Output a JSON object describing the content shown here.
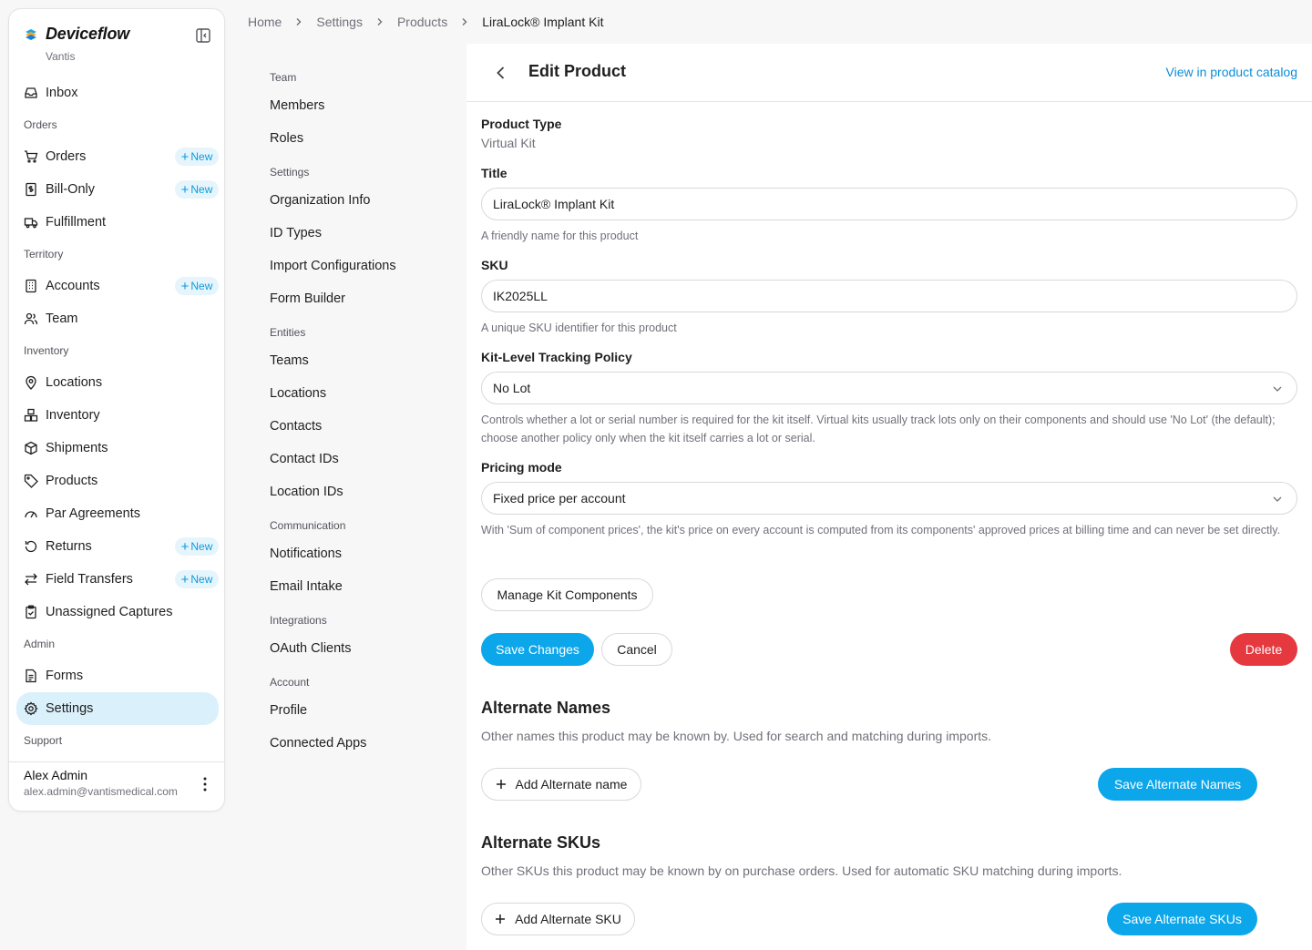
{
  "brand": {
    "name": "Deviceflow",
    "org": "Vantis"
  },
  "colors": {
    "accent": "#0ca6ea",
    "danger": "#e5383f",
    "active_nav_bg": "#daf0fb",
    "link": "#0b8fd8"
  },
  "sidebar": {
    "inbox": {
      "label": "Inbox",
      "icon": "inbox-icon"
    },
    "sections": {
      "orders": "Orders",
      "territory": "Territory",
      "inventory": "Inventory",
      "admin": "Admin",
      "support": "Support"
    },
    "new_label": "New",
    "orders": {
      "label": "Orders",
      "icon": "cart-icon"
    },
    "bill_only": {
      "label": "Bill-Only",
      "icon": "dollar-doc-icon"
    },
    "fulfillment": {
      "label": "Fulfillment",
      "icon": "truck-icon"
    },
    "accounts": {
      "label": "Accounts",
      "icon": "building-icon"
    },
    "team": {
      "label": "Team",
      "icon": "users-icon"
    },
    "locations": {
      "label": "Locations",
      "icon": "map-pin-icon"
    },
    "inventory": {
      "label": "Inventory",
      "icon": "boxes-icon"
    },
    "shipments": {
      "label": "Shipments",
      "icon": "package-icon"
    },
    "products": {
      "label": "Products",
      "icon": "tag-icon"
    },
    "par_agreements": {
      "label": "Par Agreements",
      "icon": "gauge-icon"
    },
    "returns": {
      "label": "Returns",
      "icon": "rotate-ccw-icon"
    },
    "field_transfers": {
      "label": "Field Transfers",
      "icon": "transfer-icon"
    },
    "unassigned_captures": {
      "label": "Unassigned Captures",
      "icon": "clipboard-check-icon"
    },
    "forms": {
      "label": "Forms",
      "icon": "file-text-icon"
    },
    "settings": {
      "label": "Settings",
      "icon": "gear-icon"
    }
  },
  "user": {
    "name": "Alex Admin",
    "email": "alex.admin@vantismedical.com"
  },
  "breadcrumb": {
    "home": "Home",
    "settings": "Settings",
    "products": "Products",
    "current": "LiraLock® Implant Kit"
  },
  "subnav": {
    "team_section": "Team",
    "members": "Members",
    "roles": "Roles",
    "settings_section": "Settings",
    "organization_info": "Organization Info",
    "id_types": "ID Types",
    "import_configurations": "Import Configurations",
    "form_builder": "Form Builder",
    "entities_section": "Entities",
    "teams": "Teams",
    "locations": "Locations",
    "contacts": "Contacts",
    "contact_ids": "Contact IDs",
    "location_ids": "Location IDs",
    "communication_section": "Communication",
    "notifications": "Notifications",
    "email_intake": "Email Intake",
    "integrations_section": "Integrations",
    "oauth_clients": "OAuth Clients",
    "account_section": "Account",
    "profile": "Profile",
    "connected_apps": "Connected Apps"
  },
  "edit": {
    "title": "Edit Product",
    "catalog_link": "View in product catalog",
    "product_type_label": "Product Type",
    "product_type_value": "Virtual Kit",
    "title_label": "Title",
    "title_value": "LiraLock® Implant Kit",
    "title_help": "A friendly name for this product",
    "sku_label": "SKU",
    "sku_value": "IK2025LL",
    "sku_help": "A unique SKU identifier for this product",
    "tracking_label": "Kit-Level Tracking Policy",
    "tracking_value": "No Lot",
    "tracking_help": "Controls whether a lot or serial number is required for the kit itself. Virtual kits usually track lots only on their components and should use 'No Lot' (the default); choose another policy only when the kit itself carries a lot or serial.",
    "pricing_label": "Pricing mode",
    "pricing_value": "Fixed price per account",
    "pricing_help": "With 'Sum of component prices', the kit's price on every account is computed from its components' approved prices at billing time and can never be set directly.",
    "manage_components": "Manage Kit Components",
    "save_changes": "Save Changes",
    "cancel": "Cancel",
    "delete": "Delete"
  },
  "alt_names": {
    "title": "Alternate Names",
    "desc": "Other names this product may be known by. Used for search and matching during imports.",
    "add_button": "Add Alternate name",
    "save_button": "Save Alternate Names"
  },
  "alt_skus": {
    "title": "Alternate SKUs",
    "desc": "Other SKUs this product may be known by on purchase orders. Used for automatic SKU matching during imports.",
    "add_button": "Add Alternate SKU",
    "save_button": "Save Alternate SKUs"
  }
}
